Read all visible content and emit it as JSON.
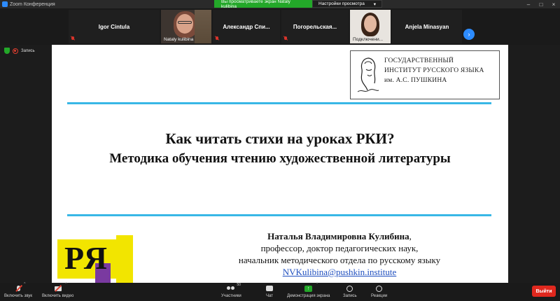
{
  "window": {
    "title": "Zoom Конференция",
    "controls": [
      "–",
      "□",
      "×"
    ]
  },
  "share_banner": {
    "status": "Вы просматриваете экран Nataly kulibina",
    "view_options": "Настройки просмотра",
    "view_caret": "▾"
  },
  "participants": [
    {
      "name": "Igor Cintula",
      "muted": true
    },
    {
      "name": "Nataly kulibina",
      "video": true,
      "muted": true
    },
    {
      "name": "Александр  Спи...",
      "muted": true
    },
    {
      "name": "Погорельская...",
      "muted": true
    },
    {
      "name": "Подключени...",
      "video": true,
      "muted": true
    },
    {
      "name": "Anjela Minasyan",
      "muted": true
    }
  ],
  "strip_next_icon": "chevron-right-icon",
  "strip_next_glyph": "›",
  "indicators": {
    "record_label": "Запись"
  },
  "slide": {
    "logo_lines": [
      "ГОСУДАРСТВЕННЫЙ",
      "ИНСТИТУТ РУССКОГО ЯЗЫКА",
      "им. А.С. ПУШКИНА"
    ],
    "title": "Как читать стихи на уроках РКИ?",
    "subtitle": "Методика обучения чтению художественной литературы",
    "author_name": "Наталья Владимировна Кулибина",
    "author_comma": ",",
    "author_line2": "профессор, доктор педагогических наук,",
    "author_line3": "начальник  методического отдела по русскому языку",
    "author_email": "NVKulibina@pushkin.institute",
    "ry_logo_text": "РЯ",
    "accent_color": "#38b7e6"
  },
  "toolbar": {
    "mute_label": "Включить звук",
    "video_label": "Включить видео",
    "participants_label": "Участники",
    "participants_count": "50",
    "chat_label": "Чат",
    "share_label": "Демонстрация экрана",
    "record_label": "Запись",
    "reactions_label": "Реакции",
    "leave_label": "Выйти",
    "caret": "^",
    "share_glyph": "↑",
    "leave_color": "#e0281e",
    "share_color": "#23a829"
  }
}
